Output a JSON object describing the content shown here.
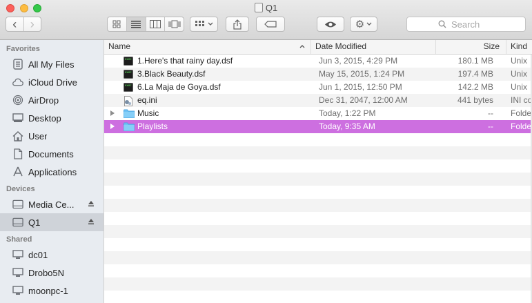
{
  "window": {
    "title": "Q1"
  },
  "toolbar": {
    "back_label": "‹",
    "forward_label": "›",
    "search_placeholder": "Search"
  },
  "sidebar": {
    "favorites_header": "Favorites",
    "favorites": [
      {
        "label": "All My Files",
        "icon": "all-files-icon"
      },
      {
        "label": "iCloud Drive",
        "icon": "cloud-icon"
      },
      {
        "label": "AirDrop",
        "icon": "airdrop-icon"
      },
      {
        "label": "Desktop",
        "icon": "desktop-icon"
      },
      {
        "label": "User",
        "icon": "home-icon"
      },
      {
        "label": "Documents",
        "icon": "documents-icon"
      },
      {
        "label": "Applications",
        "icon": "applications-icon"
      }
    ],
    "devices_header": "Devices",
    "devices": [
      {
        "label": "Media Ce...",
        "icon": "drive-icon"
      },
      {
        "label": "Q1",
        "icon": "drive-icon"
      }
    ],
    "shared_header": "Shared",
    "shared": [
      {
        "label": "dc01",
        "icon": "computer-icon"
      },
      {
        "label": "Drobo5N",
        "icon": "computer-icon"
      },
      {
        "label": "moonpc-1",
        "icon": "computer-icon"
      }
    ]
  },
  "columns": {
    "name": "Name",
    "date": "Date Modified",
    "size": "Size",
    "kind": "Kind"
  },
  "files": [
    {
      "name": "1.Here's that rainy day.dsf",
      "date": "Jun 3, 2015, 4:29 PM",
      "size": "180.1 MB",
      "kind": "Unix",
      "type": "exec",
      "folder": false
    },
    {
      "name": "3.Black Beauty.dsf",
      "date": "May 15, 2015, 1:24 PM",
      "size": "197.4 MB",
      "kind": "Unix",
      "type": "exec",
      "folder": false
    },
    {
      "name": "6.La Maja de Goya.dsf",
      "date": "Jun 1, 2015, 12:50 PM",
      "size": "142.2 MB",
      "kind": "Unix",
      "type": "exec",
      "folder": false
    },
    {
      "name": "eq.ini",
      "date": "Dec 31, 2047, 12:00 AM",
      "size": "441 bytes",
      "kind": "INI co",
      "type": "ini",
      "folder": false
    },
    {
      "name": "Music",
      "date": "Today, 1:22 PM",
      "size": "--",
      "kind": "Folde",
      "type": "folder",
      "folder": true
    },
    {
      "name": "Playlists",
      "date": "Today, 9:35 AM",
      "size": "--",
      "kind": "Folde",
      "type": "folder",
      "folder": true,
      "selected": true
    }
  ],
  "colors": {
    "selection": "#cd6fe0",
    "sidebar_bg": "#e8ecf1",
    "folder": "#5fb7ef"
  }
}
